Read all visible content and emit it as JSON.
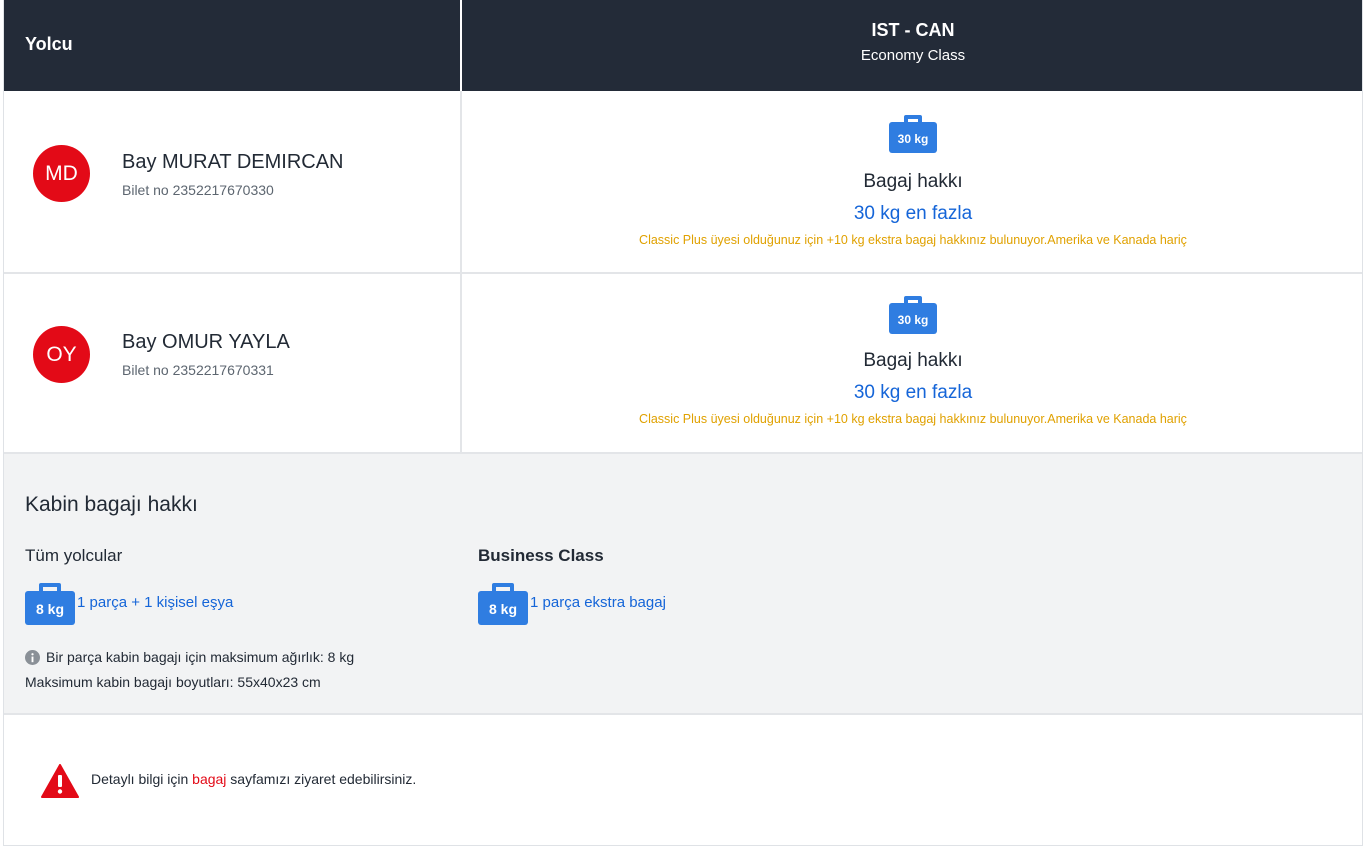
{
  "header": {
    "passenger_col": "Yolcu",
    "route": "IST - CAN",
    "cabin_class": "Economy Class"
  },
  "passengers": [
    {
      "initials": "MD",
      "name": "Bay MURAT DEMIRCAN",
      "ticket": "Bilet no 2352217670330",
      "bag_weight": "30 kg",
      "allowance_title": "Bagaj hakkı",
      "allowance_value": "30 kg en fazla",
      "note": "Classic Plus üyesi olduğunuz için +10 kg ekstra bagaj hakkınız bulunuyor.Amerika ve Kanada hariç"
    },
    {
      "initials": "OY",
      "name": "Bay OMUR YAYLA",
      "ticket": "Bilet no 2352217670331",
      "bag_weight": "30 kg",
      "allowance_title": "Bagaj hakkı",
      "allowance_value": "30 kg en fazla",
      "note": "Classic Plus üyesi olduğunuz için +10 kg ekstra bagaj hakkınız bulunuyor.Amerika ve Kanada hariç"
    }
  ],
  "cabin": {
    "title": "Kabin bagajı hakkı",
    "all": {
      "label": "Tüm yolcular",
      "bag_weight": "8 kg",
      "link": "1 parça + 1 kişisel eşya"
    },
    "business": {
      "label": "Business Class",
      "bag_weight": "8 kg",
      "link": "1 parça ekstra bagaj"
    },
    "info_line1": "Bir parça kabin bagajı için maksimum ağırlık: 8 kg",
    "info_line2": "Maksimum kabin bagajı boyutları: 55x40x23 cm"
  },
  "footer": {
    "text_before": "Detaylı bilgi için ",
    "link": "bagaj",
    "text_after": " sayfamızı ziyaret edebilirsiniz."
  },
  "colors": {
    "header_bg": "#232b38",
    "accent_red": "#e30a17",
    "link_blue": "#1565d8",
    "note_amber": "#e0a100",
    "bag_blue": "#2f7de1"
  }
}
